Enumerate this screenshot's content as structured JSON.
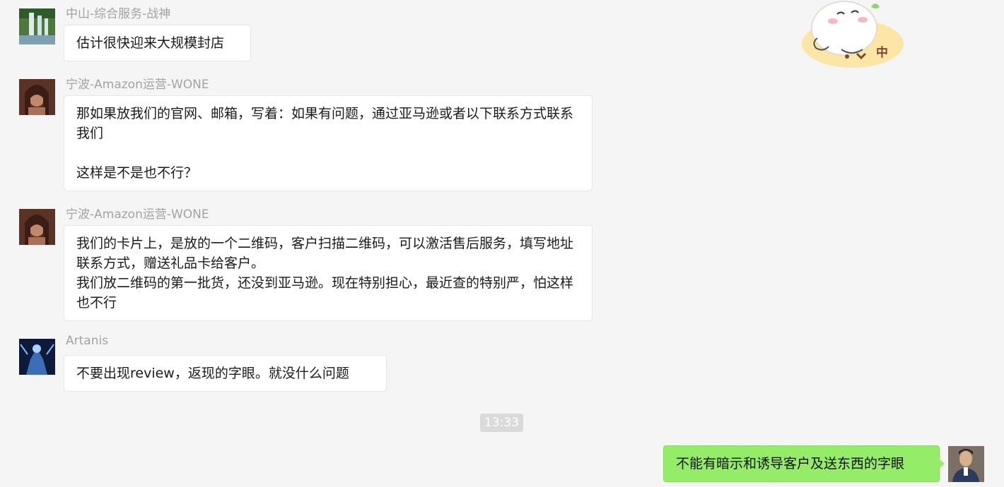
{
  "sticker": {
    "text": "中"
  },
  "messages": [
    {
      "sender": "中山-综合服务-战神",
      "text": "估计很快迎来大规模封店",
      "avatar": "waterfall-avatar"
    },
    {
      "sender": "宁波-Amazon运营-WONE",
      "text": "那如果放我们的官网、邮箱，写着：如果有问题，通过亚马逊或者以下联系方式联系我们\n\n这样是不是也不行？",
      "avatar": "woman-portrait-avatar"
    },
    {
      "sender": "宁波-Amazon运营-WONE",
      "text": "我们的卡片上，是放的一个二维码，客户扫描二维码，可以激活售后服务，填写地址联系方式，赠送礼品卡给客户。\n我们放二维码的第一批货，还没到亚马逊。现在特别担心，最近查的特别严，怕这样也不行",
      "avatar": "woman-portrait-avatar"
    },
    {
      "sender": "Artanis",
      "text": "不要出现review，返现的字眼。就没什么问题",
      "avatar": "game-character-avatar"
    }
  ],
  "timestamp": "13:33",
  "my_message": {
    "text": "不能有暗示和诱导客户及送东西的字眼",
    "avatar": "man-portrait-avatar"
  },
  "colors": {
    "background": "#f5f5f5",
    "incoming_bubble": "#ffffff",
    "outgoing_bubble": "#95ec69",
    "sender_name": "#a3a3a3",
    "timestamp_bg": "#dadada"
  }
}
